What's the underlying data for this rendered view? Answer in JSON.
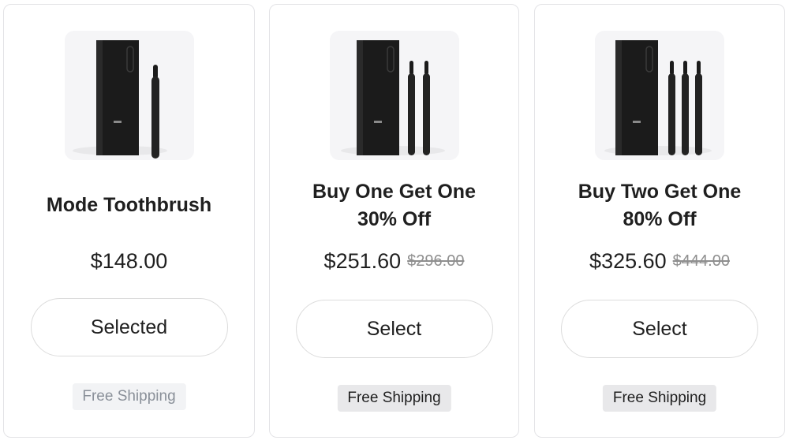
{
  "products": [
    {
      "title_lines": [
        "Mode Toothbrush"
      ],
      "price": "$148.00",
      "compare_price": "",
      "button_label": "Selected",
      "shipping_label": "Free Shipping",
      "brushes": 1
    },
    {
      "title_lines": [
        "Buy One Get One",
        "30% Off"
      ],
      "price": "$251.60",
      "compare_price": "$296.00",
      "button_label": "Select",
      "shipping_label": "Free Shipping",
      "brushes": 2
    },
    {
      "title_lines": [
        "Buy Two Get One",
        "80% Off"
      ],
      "price": "$325.60",
      "compare_price": "$444.00",
      "button_label": "Select",
      "shipping_label": "Free Shipping",
      "brushes": 3
    }
  ],
  "colors": {
    "text": "#1f1f1f",
    "border": "#e3e3e6",
    "image_bg": "#f5f5f7",
    "strike": "#8f8f8f",
    "muted_badge_text": "#8a9099"
  }
}
